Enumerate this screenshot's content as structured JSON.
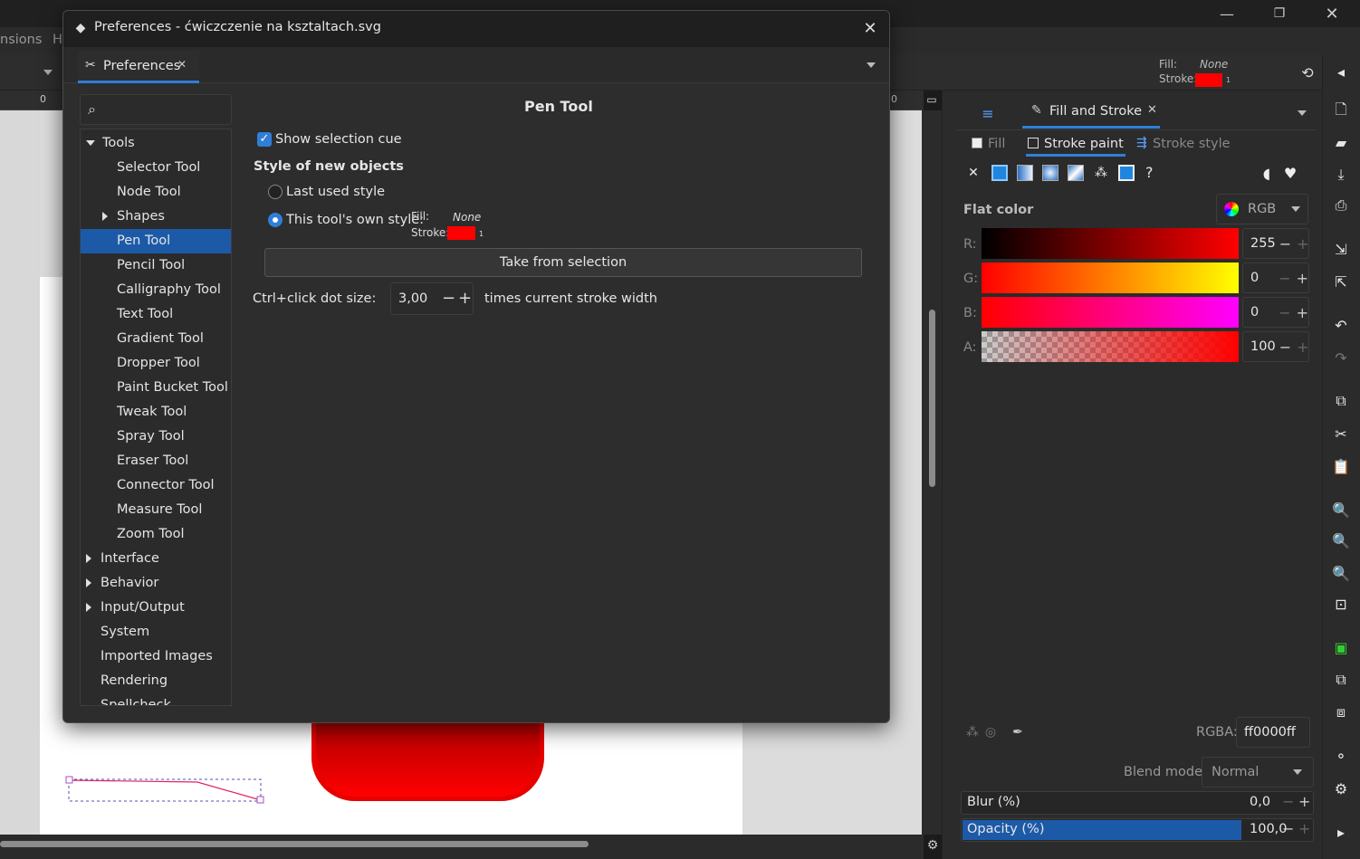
{
  "main_window": {
    "menu_partial": [
      "nsions",
      "H"
    ],
    "indicator": {
      "fill_label": "Fill:",
      "fill_value": "None",
      "stroke_label": "Stroke:",
      "stroke_width": "1",
      "stroke_color": "#ff0000"
    },
    "ruler_zero": "0",
    "ruler_zero_right": "0"
  },
  "dialog": {
    "title": "Preferences - ćwiczczenie na ksztaltach.svg",
    "tab_label": "Preferences",
    "search_placeholder": "",
    "tree": {
      "tools": "Tools",
      "tool_items": [
        "Selector Tool",
        "Node Tool",
        "Shapes",
        "Pen Tool",
        "Pencil Tool",
        "Calligraphy Tool",
        "Text Tool",
        "Gradient Tool",
        "Dropper Tool",
        "Paint Bucket Tool",
        "Tweak Tool",
        "Spray Tool",
        "Eraser Tool",
        "Connector Tool",
        "Measure Tool",
        "Zoom Tool"
      ],
      "top_items": [
        "Interface",
        "Behavior",
        "Input/Output",
        "System",
        "Imported Images",
        "Rendering",
        "Spellcheck"
      ],
      "selected": "Pen Tool"
    },
    "page": {
      "heading": "Pen Tool",
      "show_selection_cue": "Show selection cue",
      "style_heading": "Style of new objects",
      "last_used_style": "Last used style",
      "own_style": "This tool's own style:",
      "fill_label": "Fill:",
      "fill_value": "None",
      "stroke_label": "Stroke:",
      "stroke_width": "1",
      "take_from_selection": "Take from selection",
      "dot_size_label": "Ctrl+click dot size:",
      "dot_size_value": "3,00",
      "dot_size_suffix": "times current stroke width"
    }
  },
  "fill_stroke": {
    "tab_label": "Fill and Stroke",
    "sub_tabs": [
      "Fill",
      "Stroke paint",
      "Stroke style"
    ],
    "active_sub_tab": "Stroke paint",
    "mode_label": "Flat color",
    "color_model": "RGB",
    "channels": [
      {
        "label": "R:",
        "value": "255"
      },
      {
        "label": "G:",
        "value": "0"
      },
      {
        "label": "B:",
        "value": "0"
      },
      {
        "label": "A:",
        "value": "100"
      }
    ],
    "rgba_label": "RGBA:",
    "rgba_value": "ff0000ff",
    "blend_label": "Blend mode:",
    "blend_value": "Normal",
    "blur_label": "Blur (%)",
    "blur_value": "0,0",
    "opacity_label": "Opacity (%)",
    "opacity_value": "100,0",
    "unknown_icon": "?"
  },
  "colors": {
    "accent": "#1c5aa8",
    "red": "#ff0000",
    "dialog_bg": "#2d2d2d"
  }
}
